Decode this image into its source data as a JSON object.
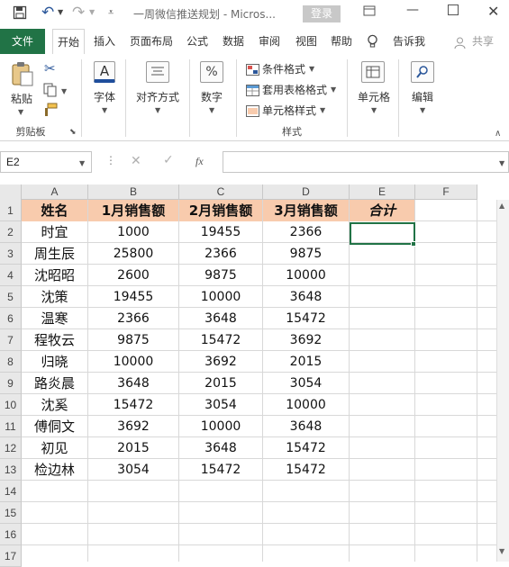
{
  "title_bar": {
    "doc_title": "一周微信推送规划  -  Micros...",
    "login_label": "登录"
  },
  "tabs": [
    "文件",
    "开始",
    "插入",
    "页面布局",
    "公式",
    "数据",
    "审阅",
    "视图",
    "帮助",
    "告诉我",
    "共享"
  ],
  "ribbon": {
    "paste": "粘贴",
    "clipboard_group": "剪贴板",
    "font": "字体",
    "align": "对齐方式",
    "number": "数字",
    "cond_format": "条件格式",
    "table_format": "套用表格格式",
    "cell_style": "单元格样式",
    "styles_group": "样式",
    "cells": "单元格",
    "editing": "编辑",
    "font_icon": "A",
    "number_icon": "%"
  },
  "formula_bar": {
    "name_box": "E2",
    "fx": "fx"
  },
  "sheet": {
    "columns": [
      "A",
      "B",
      "C",
      "D",
      "E",
      "F"
    ],
    "row_numbers": [
      "1",
      "2",
      "3",
      "4",
      "5",
      "6",
      "7",
      "8",
      "9",
      "10",
      "11",
      "12",
      "13",
      "14",
      "15",
      "16",
      "17"
    ],
    "header_row": [
      "姓名",
      "1月销售额",
      "2月销售额",
      "3月销售额",
      "合计"
    ],
    "rows": [
      [
        "时宜",
        "1000",
        "19455",
        "2366"
      ],
      [
        "周生辰",
        "25800",
        "2366",
        "9875"
      ],
      [
        "沈昭昭",
        "2600",
        "9875",
        "10000"
      ],
      [
        "沈策",
        "19455",
        "10000",
        "3648"
      ],
      [
        "温寒",
        "2366",
        "3648",
        "15472"
      ],
      [
        "程牧云",
        "9875",
        "15472",
        "3692"
      ],
      [
        "归晓",
        "10000",
        "3692",
        "2015"
      ],
      [
        "路炎晨",
        "3648",
        "2015",
        "3054"
      ],
      [
        "沈奚",
        "15472",
        "3054",
        "10000"
      ],
      [
        "傅侗文",
        "3692",
        "10000",
        "3648"
      ],
      [
        "初见",
        "2015",
        "3648",
        "15472"
      ],
      [
        "检边林",
        "3054",
        "15472",
        "15472"
      ]
    ],
    "header_fill": "#f8cbad",
    "selected_cell": "E2"
  },
  "colors": {
    "file_tab": "#217346",
    "header_fill": "#f8cbad",
    "selection": "#217346"
  }
}
